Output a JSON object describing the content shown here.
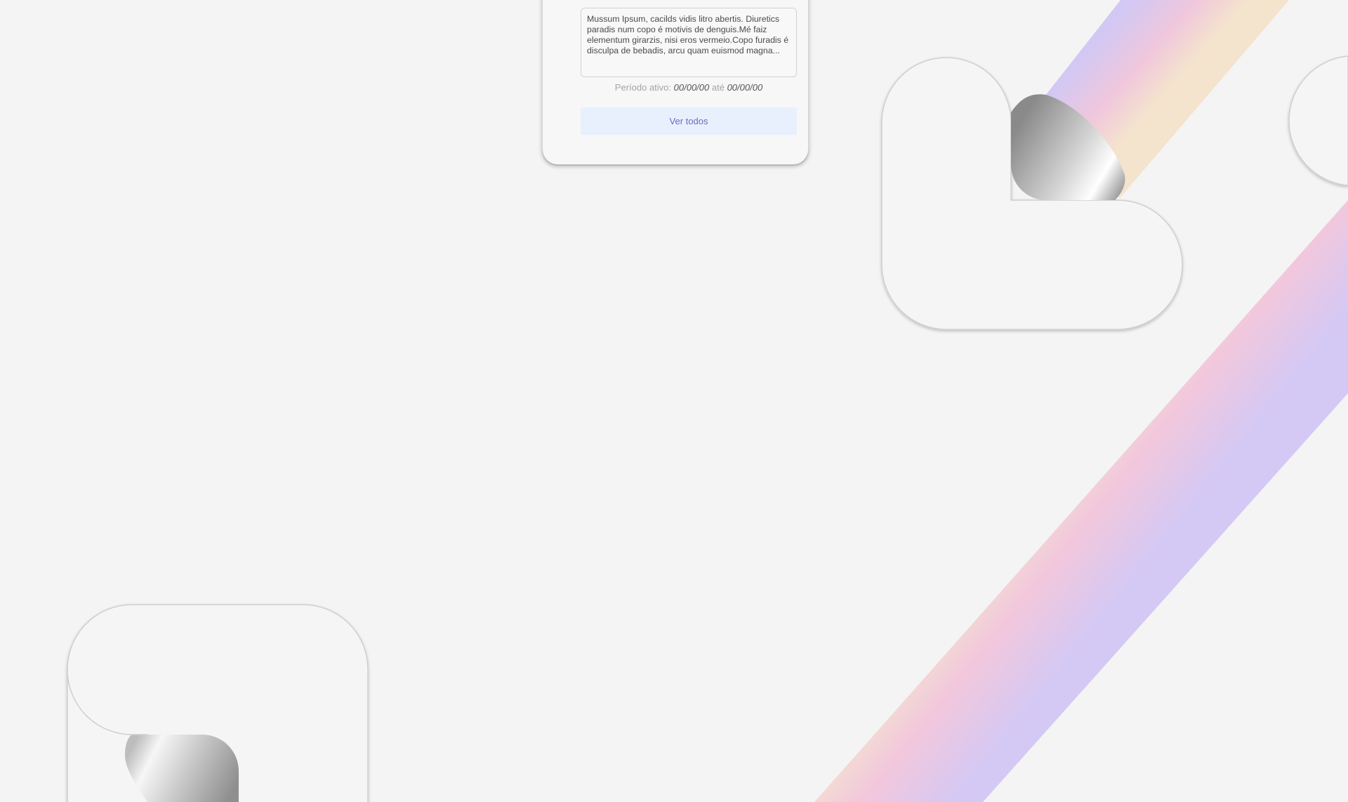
{
  "card": {
    "description": "Mussum Ipsum, cacilds vidis litro abertis. Diuretics paradis num copo é motivis de denguis.Mé faiz elementum girarzis, nisi eros vermeio.Copo furadis é disculpa de bebadis, arcu quam euismod magna...",
    "period": {
      "label": "Período ativo:",
      "start": "00/00/00",
      "separator": "até",
      "end": "00/00/00"
    },
    "see_all_label": "Ver todos"
  },
  "colors": {
    "background": "#f4f4f4",
    "button_bg": "#e8f0fd",
    "button_text": "#6f68c2",
    "ribbon_peach": "#f3dcc8",
    "ribbon_pink": "#f2c6dc",
    "ribbon_lavender": "#d6c8f4"
  }
}
